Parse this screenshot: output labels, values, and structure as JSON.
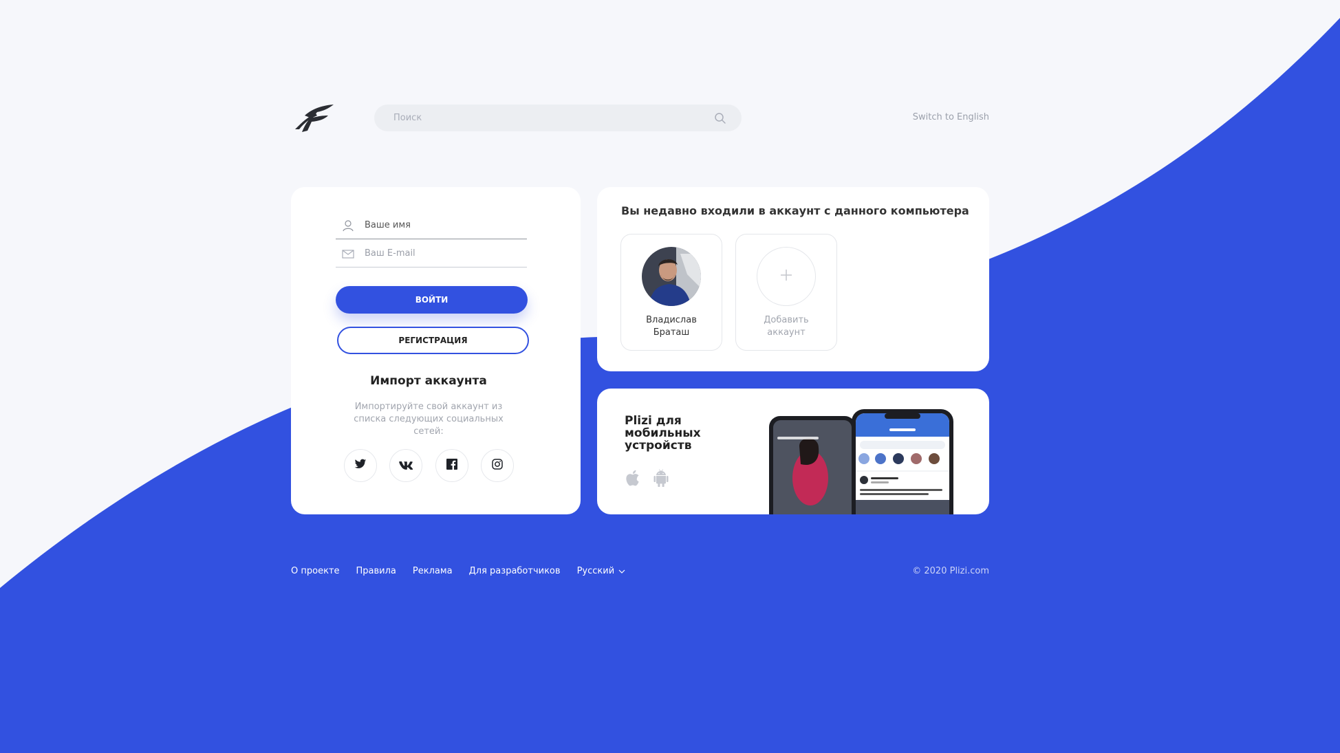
{
  "header": {
    "search_placeholder": "Поиск",
    "switch_language": "Switch to English"
  },
  "login": {
    "name_placeholder": "Ваше имя",
    "email_placeholder": "Ваш E-mail",
    "login_button": "ВОЙТИ",
    "register_button": "РЕГИСТРАЦИЯ",
    "import_title": "Импорт аккаунта",
    "import_description": "Импортируйте свой аккаунт из списка следующих социальных сетей:",
    "social": [
      {
        "icon": "twitter-icon"
      },
      {
        "icon": "vk-icon"
      },
      {
        "icon": "facebook-icon"
      },
      {
        "icon": "instagram-icon"
      }
    ]
  },
  "recent": {
    "title": "Вы недавно входили в аккаунт с данного компьютера",
    "accounts": [
      {
        "name": "Владислав Браташ"
      }
    ],
    "add_account": "Добавить аккаунт"
  },
  "mobile": {
    "title": "Plizi для мобильных устройств",
    "stores": [
      "apple-icon",
      "android-icon"
    ]
  },
  "footer": {
    "links": [
      "О проекте",
      "Правила",
      "Реклама",
      "Для разработчиков"
    ],
    "language": "Русский",
    "copyright": "© 2020 Plizi.com"
  },
  "colors": {
    "accent": "#3251e0",
    "background": "#f6f7fb"
  }
}
